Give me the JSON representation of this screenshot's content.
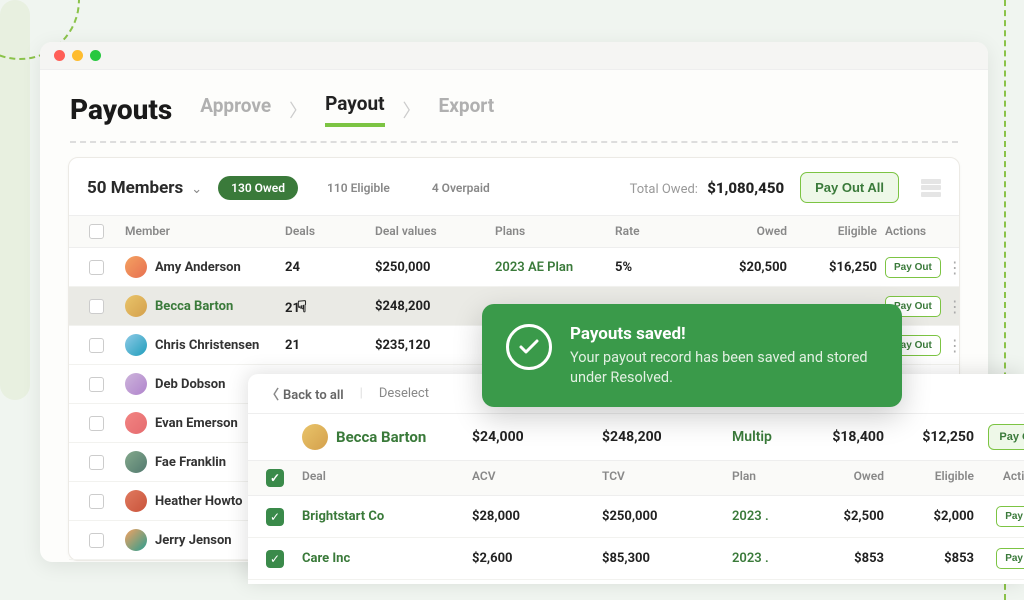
{
  "page": {
    "title": "Payouts"
  },
  "steps": {
    "approve": "Approve",
    "payout": "Payout",
    "export": "Export"
  },
  "summary": {
    "members_label": "50 Members",
    "owed_pill": "130 Owed",
    "eligible_pill": "110 Eligible",
    "overpaid_pill": "4 Overpaid",
    "total_owed_label": "Total Owed:",
    "total_owed_value": "$1,080,450",
    "pay_all_btn": "Pay Out All"
  },
  "columns": {
    "member": "Member",
    "deals": "Deals",
    "deal_values": "Deal values",
    "plans": "Plans",
    "rate": "Rate",
    "owed": "Owed",
    "eligible": "Eligible",
    "actions": "Actions"
  },
  "rows": [
    {
      "name": "Amy Anderson",
      "deals": "24",
      "deal_values": "$250,000",
      "plan": "2023 AE Plan",
      "rate": "5%",
      "owed": "$20,500",
      "eligible": "$16,250"
    },
    {
      "name": "Becca Barton",
      "deals": "21",
      "deal_values": "$248,200",
      "plan": "",
      "rate": "",
      "owed": "",
      "eligible": ""
    },
    {
      "name": "Chris Christensen",
      "deals": "21",
      "deal_values": "$235,120",
      "plan": "",
      "rate": "",
      "owed": "",
      "eligible": ""
    },
    {
      "name": "Deb Dobson",
      "deals": "",
      "deal_values": "",
      "plan": "",
      "rate": "",
      "owed": "",
      "eligible": ""
    },
    {
      "name": "Evan Emerson",
      "deals": "",
      "deal_values": "",
      "plan": "",
      "rate": "",
      "owed": "",
      "eligible": ""
    },
    {
      "name": "Fae Franklin",
      "deals": "",
      "deal_values": "",
      "plan": "",
      "rate": "",
      "owed": "",
      "eligible": ""
    },
    {
      "name": "Heather Howto",
      "deals": "",
      "deal_values": "",
      "plan": "",
      "rate": "",
      "owed": "",
      "eligible": ""
    },
    {
      "name": "Jerry Jenson",
      "deals": "",
      "deal_values": "",
      "plan": "",
      "rate": "",
      "owed": "",
      "eligible": ""
    }
  ],
  "row_btn": "Pay Out",
  "detail": {
    "back": "Back to all",
    "deselect": "Deselect",
    "member": {
      "name": "Becca Barton",
      "acv": "$24,000",
      "tcv": "$248,200",
      "plan": "Multip",
      "owed": "$18,400",
      "eligible": "$12,250"
    },
    "cols": {
      "deal": "Deal",
      "acv": "ACV",
      "tcv": "TCV",
      "plan": "Plan",
      "owed": "Owed",
      "eligible": "Eligible",
      "actions": "Actions"
    },
    "deals": [
      {
        "name": "Brightstart Co",
        "acv": "$28,000",
        "tcv": "$250,000",
        "plan": "2023 .",
        "owed": "$2,500",
        "eligible": "$2,000"
      },
      {
        "name": "Care Inc",
        "acv": "$2,600",
        "tcv": "$85,300",
        "plan": "2023 .",
        "owed": "$853",
        "eligible": "$853"
      }
    ],
    "payout_btn": "Pay Out"
  },
  "toast": {
    "title": "Payouts saved!",
    "body": "Your payout record has been saved and stored under Resolved."
  }
}
